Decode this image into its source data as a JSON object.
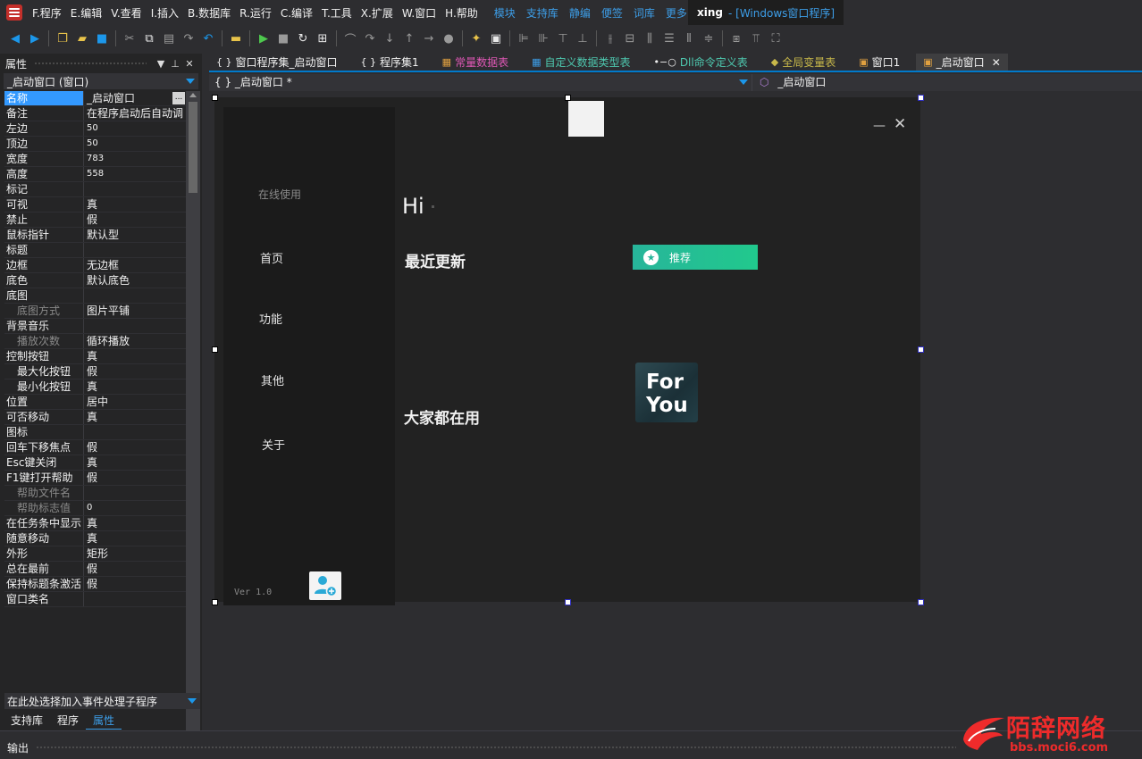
{
  "menubar": {
    "items": [
      "F.程序",
      "E.编辑",
      "V.查看",
      "I.插入",
      "B.数据库",
      "R.运行",
      "C.编译",
      "T.工具",
      "X.扩展",
      "W.窗口",
      "H.帮助"
    ],
    "links": [
      "模块",
      "支持库",
      "静编",
      "便签",
      "词库",
      "更多"
    ],
    "project": "xing",
    "title_rest": "- [Windows窗口程序]"
  },
  "toolbar": {
    "icons": [
      "back-icon",
      "forward-icon",
      "new-file-icon",
      "open-folder-icon",
      "save-icon",
      "cut-icon",
      "copy-icon",
      "paste-icon",
      "redo-icon",
      "undo-icon",
      "open-project-icon",
      "run-icon",
      "stop-icon",
      "restart-icon",
      "compile-icon",
      "step-over-icon",
      "step-out-icon",
      "step-into-icon",
      "step-up-icon",
      "goto-icon",
      "breakpoint-icon",
      "lightbulb-icon",
      "window-props-icon",
      "align-left-icon",
      "align-right-icon",
      "align-top-icon",
      "align-bottom-icon",
      "align-center-v-icon",
      "align-center-h-icon",
      "distribute-h-icon",
      "distribute-v-icon",
      "same-width-icon",
      "same-height-icon",
      "center-form-icon",
      "tab-order-icon",
      "lock-icon"
    ]
  },
  "props": {
    "title": "属性",
    "selector": "_启动窗口 (窗口)",
    "event_placeholder": "在此处选择加入事件处理子程序",
    "rows": [
      {
        "name": "名称",
        "value": "_启动窗口"
      },
      {
        "name": "备注",
        "value": "在程序启动后自动调"
      },
      {
        "name": "左边",
        "value": "50"
      },
      {
        "name": "顶边",
        "value": "50"
      },
      {
        "name": "宽度",
        "value": "783"
      },
      {
        "name": "高度",
        "value": "558"
      },
      {
        "name": "标记",
        "value": ""
      },
      {
        "name": "可视",
        "value": "真"
      },
      {
        "name": "禁止",
        "value": "假"
      },
      {
        "name": "鼠标指针",
        "value": "默认型"
      },
      {
        "name": "标题",
        "value": ""
      },
      {
        "name": "边框",
        "value": "无边框"
      },
      {
        "name": "底色",
        "value": "默认底色"
      },
      {
        "name": "底图",
        "value": ""
      },
      {
        "name": "底图方式",
        "value": "图片平铺"
      },
      {
        "name": "背景音乐",
        "value": ""
      },
      {
        "name": "播放次数",
        "value": "循环播放"
      },
      {
        "name": "控制按钮",
        "value": "真"
      },
      {
        "name": "最大化按钮",
        "value": "假"
      },
      {
        "name": "最小化按钮",
        "value": "真"
      },
      {
        "name": "位置",
        "value": "居中"
      },
      {
        "name": "可否移动",
        "value": "真"
      },
      {
        "name": "图标",
        "value": ""
      },
      {
        "name": "回车下移焦点",
        "value": "假"
      },
      {
        "name": "Esc键关闭",
        "value": "真"
      },
      {
        "name": "F1键打开帮助",
        "value": "假"
      },
      {
        "name": "帮助文件名",
        "value": ""
      },
      {
        "name": "帮助标志值",
        "value": "0"
      },
      {
        "name": "在任务条中显示",
        "value": "真"
      },
      {
        "name": "随意移动",
        "value": "真"
      },
      {
        "name": "外形",
        "value": "矩形"
      },
      {
        "name": "总在最前",
        "value": "假"
      },
      {
        "name": "保持标题条激活",
        "value": "假"
      },
      {
        "name": "窗口类名",
        "value": ""
      }
    ]
  },
  "left_tabs": [
    "支持库",
    "程序",
    "属性"
  ],
  "doc_tabs": [
    {
      "icon": "{ }",
      "label": "窗口程序集_启动窗口"
    },
    {
      "icon": "{ }",
      "label": "程序集1"
    },
    {
      "icon": "▦",
      "label": "常量数据表"
    },
    {
      "icon": "▦",
      "label": "自定义数据类型表"
    },
    {
      "icon": "•−○",
      "label": "Dll命令定义表"
    },
    {
      "icon": "◆",
      "label": "全局变量表"
    },
    {
      "icon": "▣",
      "label": "窗口1"
    },
    {
      "icon": "▣",
      "label": "_启动窗口"
    }
  ],
  "combo": {
    "left": "{ } _启动窗口 *",
    "right": "_启动窗口"
  },
  "form": {
    "nav_online": "在线使用",
    "nav_home": "首页",
    "nav_features": "功能",
    "nav_other": "其他",
    "nav_about": "关于",
    "version": "Ver 1.0",
    "hi": "Hi",
    "recent": "最近更新",
    "recommend": "推荐",
    "everyone": "大家都在用",
    "foryou_line1": "For",
    "foryou_line2": "You",
    "minimize": "—",
    "close": "✕"
  },
  "output": {
    "label": "输出"
  },
  "watermark": {
    "main": "陌辞网络",
    "url": "bbs.moci6.com"
  },
  "colors": {
    "accent": "#007acc",
    "link": "#3d9ee8",
    "recommend_green": "#21c98d",
    "watermark_red": "#ee2b2b"
  }
}
